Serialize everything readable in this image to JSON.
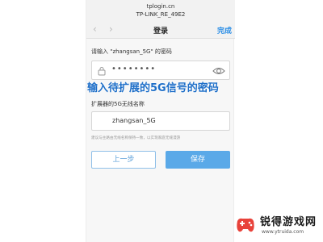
{
  "browser": {
    "url": "tplogin.cn",
    "ssid_heading": "TP-LINK_RE_49E2"
  },
  "nav": {
    "back_icon": "chevron-left-icon",
    "forward_icon": "chevron-right-icon",
    "title": "登录",
    "done_label": "完成"
  },
  "form": {
    "password_label": "请输入 \"zhangsan_5G\" 的密码",
    "password_value": "••••••••",
    "lock_icon": "lock-icon",
    "reveal_icon": "eye-icon",
    "extended_label": "扩展器的5G无线名称",
    "extended_name_value": "zhangsan_5G",
    "hint": "建议与主路由无线名称保持一致，以实现家庭无缝漫游",
    "prev_button": "上一步",
    "save_button": "保存"
  },
  "overlay": {
    "caption": "输入待扩展的5G信号的密码"
  },
  "watermark": {
    "logo_icon": "gamepad-logo-icon",
    "title": "锐得游戏网",
    "url": "www.ytruida.com"
  },
  "colors": {
    "accent": "#2b8ee6",
    "save_button": "#5aa9e8",
    "overlay_text": "#1f6fc8",
    "watermark_logo": "#e8423a"
  }
}
